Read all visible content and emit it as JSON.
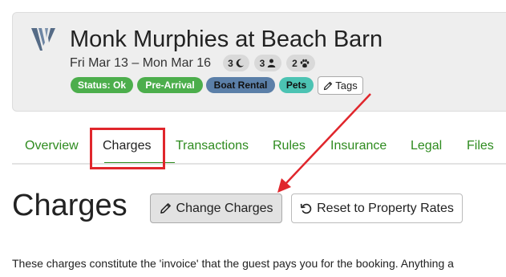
{
  "header": {
    "title": "Monk Murphies at Beach Barn",
    "dates": "Fri Mar 13  –  Mon Mar 16",
    "stats": [
      {
        "value": "3",
        "icon": "moon-icon"
      },
      {
        "value": "3",
        "icon": "person-icon"
      },
      {
        "value": "2",
        "icon": "paw-icon"
      }
    ],
    "badges": [
      {
        "label": "Status: Ok",
        "color": "#4cae4c"
      },
      {
        "label": "Pre-Arrival",
        "color": "#4cae4c"
      },
      {
        "label": "Boat Rental",
        "color": "#5b7fa8"
      },
      {
        "label": "Pets",
        "color": "#4cc3b3"
      }
    ],
    "tags_label": "Tags"
  },
  "tabs": [
    {
      "label": "Overview",
      "active": false
    },
    {
      "label": "Charges",
      "active": true
    },
    {
      "label": "Transactions",
      "active": false
    },
    {
      "label": "Rules",
      "active": false
    },
    {
      "label": "Insurance",
      "active": false
    },
    {
      "label": "Legal",
      "active": false
    },
    {
      "label": "Files",
      "active": false
    }
  ],
  "section": {
    "title": "Charges",
    "change_button": "Change Charges",
    "reset_button": "Reset to Property Rates",
    "description": "These charges constitute the 'invoice' that the guest pays you for the booking. Anything a"
  },
  "colors": {
    "accent_green": "#2e8b1f",
    "annotation_red": "#e0262c"
  }
}
